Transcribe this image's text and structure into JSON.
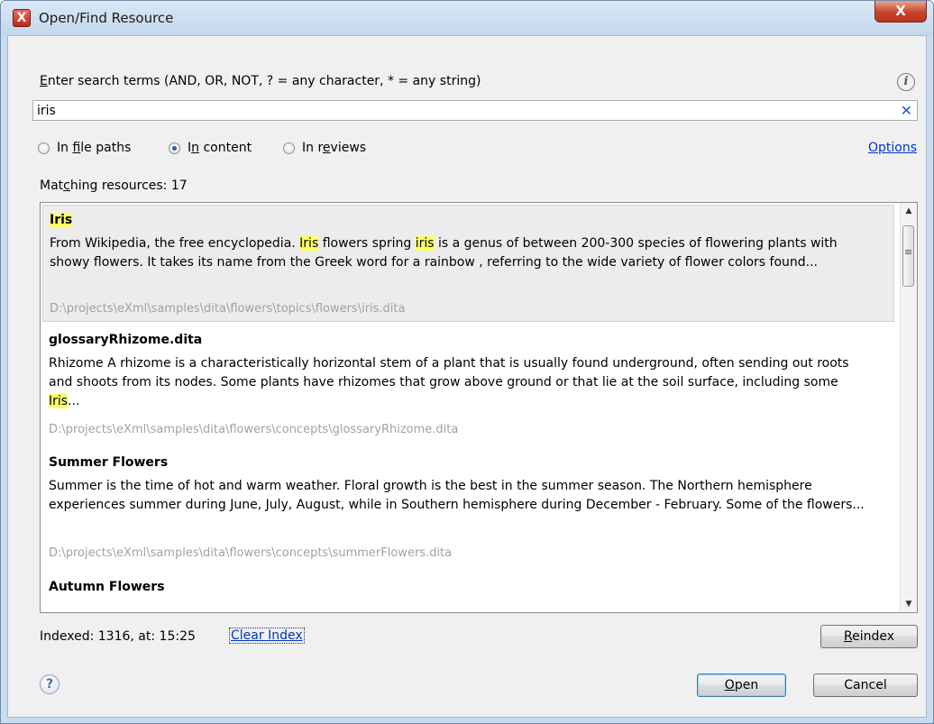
{
  "window": {
    "title": "Open/Find Resource",
    "close_glyph": "X"
  },
  "search": {
    "prompt_mnemonic": "E",
    "prompt_rest": "nter search terms (AND, OR, NOT, ? = any character, * = any string)",
    "value": "iris",
    "clear_glyph": "✕",
    "info_glyph": "i"
  },
  "scope": {
    "file_paths": {
      "pre": "In ",
      "key": "f",
      "post": "ile paths",
      "selected": false
    },
    "content": {
      "pre": "I",
      "key": "n",
      "post": " content",
      "selected": true
    },
    "reviews": {
      "pre": "In r",
      "key": "e",
      "post": "views",
      "selected": false
    },
    "options_label": "Options"
  },
  "matches": {
    "pre": "Mat",
    "key": "c",
    "post": "hing resources: 17"
  },
  "results": [
    {
      "title": "Iris",
      "text": [
        {
          "t": "From Wikipedia, the free encyclopedia. "
        },
        {
          "t": "Iris",
          "hl": true
        },
        {
          "t": " flowers spring "
        },
        {
          "t": "iris",
          "hl": true
        },
        {
          "t": " is a genus of between 200-300 species of flowering plants with showy flowers. It takes its name from the Greek word for a rainbow , referring to the wide variety of flower colors found..."
        }
      ],
      "path": "D:\\projects\\eXml\\samples\\dita\\flowers\\topics\\flowers\\iris.dita",
      "selected": true
    },
    {
      "title": "glossaryRhizome.dita",
      "text": [
        {
          "t": "Rhizome A rhizome is a characteristically horizontal stem of a plant that is usually found underground, often sending out roots and shoots from its nodes. Some plants have rhizomes that grow above ground or that lie at the soil surface, including some "
        },
        {
          "t": "Iris",
          "hl": true
        },
        {
          "t": "..."
        }
      ],
      "path": "D:\\projects\\eXml\\samples\\dita\\flowers\\concepts\\glossaryRhizome.dita",
      "selected": false
    },
    {
      "title": "Summer Flowers",
      "text": [
        {
          "t": "Summer is the time of hot and warm weather. Floral growth is the best in the summer season. The Northern hemisphere experiences summer during June, July, August, while in Southern hemisphere during December - February. Some of the flowers..."
        }
      ],
      "path": "D:\\projects\\eXml\\samples\\dita\\flowers\\concepts\\summerFlowers.dita",
      "selected": false
    },
    {
      "title": "Autumn Flowers",
      "text": [],
      "path": "",
      "selected": false
    }
  ],
  "footer": {
    "indexed": "Indexed: 1316, at: 15:25",
    "clear_index": "Clear Index",
    "reindex": {
      "key": "R",
      "post": "eindex"
    },
    "open": {
      "key": "O",
      "post": "pen"
    },
    "cancel": "Cancel",
    "help_glyph": "?"
  },
  "scrollbar": {
    "up_glyph": "▲",
    "down_glyph": "▼"
  }
}
